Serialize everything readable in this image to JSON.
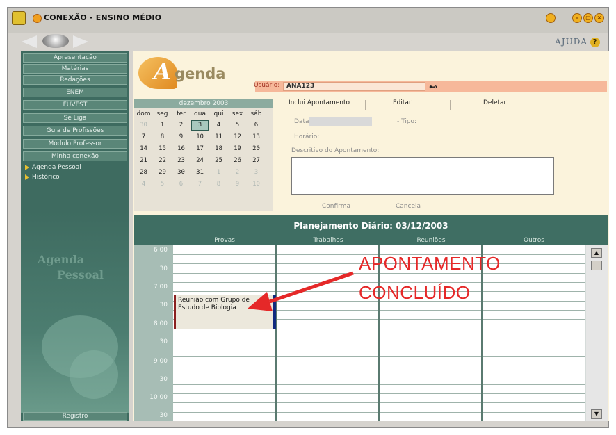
{
  "window": {
    "title": "CONEXÃO - ENSINO MÉDIO",
    "help_label": "AJUDA",
    "help_icon_glyph": "?"
  },
  "sidebar": {
    "menu": [
      {
        "label": "Apresentação"
      },
      {
        "label": "Matérias"
      },
      {
        "label": "Redações"
      },
      {
        "label": "ENEM"
      },
      {
        "label": "FUVEST"
      },
      {
        "label": "Se Liga"
      },
      {
        "label": "Guia de Profissões"
      },
      {
        "label": "Módulo Professor"
      },
      {
        "label": "Minha conexão"
      }
    ],
    "submenu": [
      {
        "label": "Agenda Pessoal"
      },
      {
        "label": "Histórico"
      }
    ],
    "art_words": [
      "Agenda",
      "Pessoal"
    ],
    "registro_label": "Registro"
  },
  "agenda": {
    "logo_letter": "A",
    "logo_text": "genda",
    "user_label": "Usuário:",
    "user_value": "ANA123"
  },
  "calendar": {
    "month_label": "dezembro 2003",
    "day_headers": [
      "dom",
      "seg",
      "ter",
      "qua",
      "qui",
      "sex",
      "sáb"
    ],
    "weeks": [
      [
        "30",
        "1",
        "2",
        "3",
        "4",
        "5",
        "6"
      ],
      [
        "7",
        "8",
        "9",
        "10",
        "11",
        "12",
        "13"
      ],
      [
        "14",
        "15",
        "16",
        "17",
        "18",
        "19",
        "20"
      ],
      [
        "21",
        "22",
        "23",
        "24",
        "25",
        "26",
        "27"
      ],
      [
        "28",
        "29",
        "30",
        "31",
        "1",
        "2",
        "3"
      ],
      [
        "4",
        "5",
        "6",
        "7",
        "8",
        "9",
        "10"
      ]
    ],
    "selected_day": "3"
  },
  "form": {
    "tabs": [
      "Inclui Apontamento",
      "Editar",
      "Deletar"
    ],
    "data_label": "Data:",
    "tipo_label": "- Tipo:",
    "horario_label": "Horário:",
    "descritivo_label": "Descritivo do Apontamento:",
    "confirma_label": "Confirma",
    "cancela_label": "Cancela"
  },
  "planner": {
    "title": "Planejamento Diário: 03/12/2003",
    "columns": [
      "Provas",
      "Trabalhos",
      "Reuniões",
      "Outros"
    ],
    "time_labels": [
      "6 00",
      "30",
      "7 00",
      "30",
      "8 00",
      "30",
      "9 00",
      "30",
      "10 00",
      "30"
    ],
    "appointment": "Reunião com Grupo de Estudo de Biologia"
  },
  "annotation": {
    "line1": "APONTAMENTO",
    "line2": "CONCLUÍDO",
    "color": "#e52828"
  }
}
